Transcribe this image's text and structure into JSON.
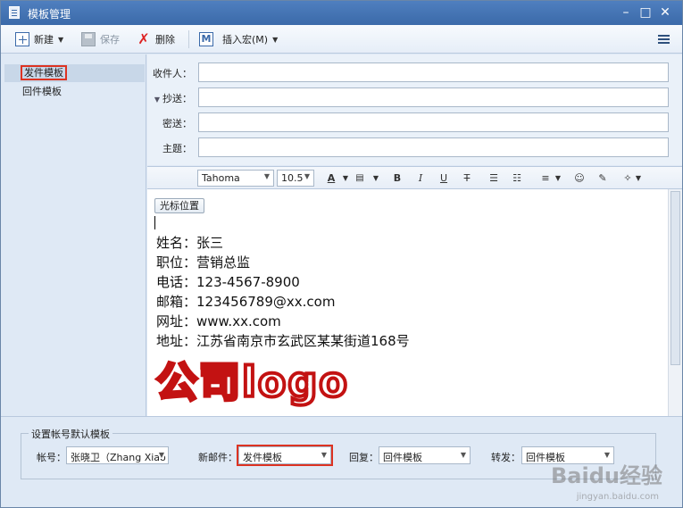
{
  "window": {
    "title": "模板管理"
  },
  "toolbar": {
    "new_label": "新建",
    "save_label": "保存",
    "delete_label": "删除",
    "insert_macro_label": "插入宏(M)"
  },
  "sidebar": {
    "items": [
      {
        "label": "发件模板",
        "selected": true
      },
      {
        "label": "回件模板",
        "selected": false
      }
    ]
  },
  "header": {
    "to_label": "收件人：",
    "cc_label": "抄送：",
    "bcc_label": "密送：",
    "subject_label": "主题：",
    "to_value": "",
    "cc_value": "",
    "bcc_value": "",
    "subject_value": ""
  },
  "format": {
    "font": "Tahoma",
    "size": "10.5"
  },
  "editor": {
    "cursor_button": "光标位置",
    "lines": [
      "姓名：张三",
      "职位：营销总监",
      "电话：123-4567-8900",
      "邮箱：123456789@xx.com",
      "网址：www.xx.com",
      "地址：江苏省南京市玄武区某某街道168号"
    ],
    "logo_text": "公司logo"
  },
  "defaults": {
    "group_title": "设置帐号默认模板",
    "account_label": "帐号：",
    "account_value": "张晓卫（Zhang Xiao",
    "new_mail_label": "新邮件：",
    "new_mail_value": "发件模板",
    "reply_label": "回复：",
    "reply_value": "回件模板",
    "forward_label": "转发：",
    "forward_value": "回件模板"
  },
  "watermark": {
    "text": "Baidu经验",
    "sub": "jingyan.baidu.com"
  },
  "colors": {
    "titlebar": "#3b6aa9",
    "highlight": "#dd3322",
    "logo": "#c31212"
  }
}
